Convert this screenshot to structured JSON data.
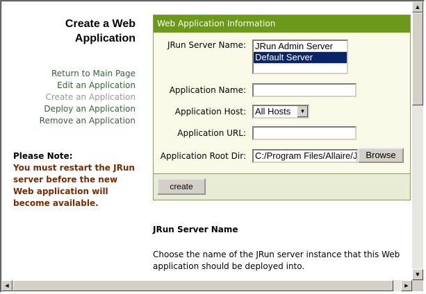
{
  "page": {
    "title": "Create a Web\nApplication"
  },
  "nav": {
    "items": [
      {
        "label": "Return to Main Page"
      },
      {
        "label": "Edit an Application"
      },
      {
        "label": "Create an Application"
      },
      {
        "label": "Deploy an Application"
      },
      {
        "label": "Remove an Application"
      }
    ]
  },
  "note": {
    "heading": "Please Note:",
    "body": "You must restart the JRun server before the new Web application will become available."
  },
  "form": {
    "header": "Web Application Information",
    "server_label": "JRun Server Name:",
    "servers": [
      "JRun Admin Server",
      "Default Server"
    ],
    "selected_server": "Default Server",
    "app_name_label": "Application Name:",
    "app_name_value": "",
    "app_host_label": "Application Host:",
    "app_host_value": "All Hosts",
    "app_url_label": "Application URL:",
    "app_url_value": "",
    "app_root_label": "Application Root Dir:",
    "app_root_value": "C:/Program Files/Allaire/J",
    "browse_label": "Browse",
    "create_label": "create"
  },
  "help": {
    "title": "JRun Server Name",
    "body": "Choose the name of the JRun server instance that this Web application should be deployed into."
  },
  "colors": {
    "header_bg": "#6b9a1a",
    "nav_link": "#336633",
    "note_text": "#7a2a00"
  }
}
